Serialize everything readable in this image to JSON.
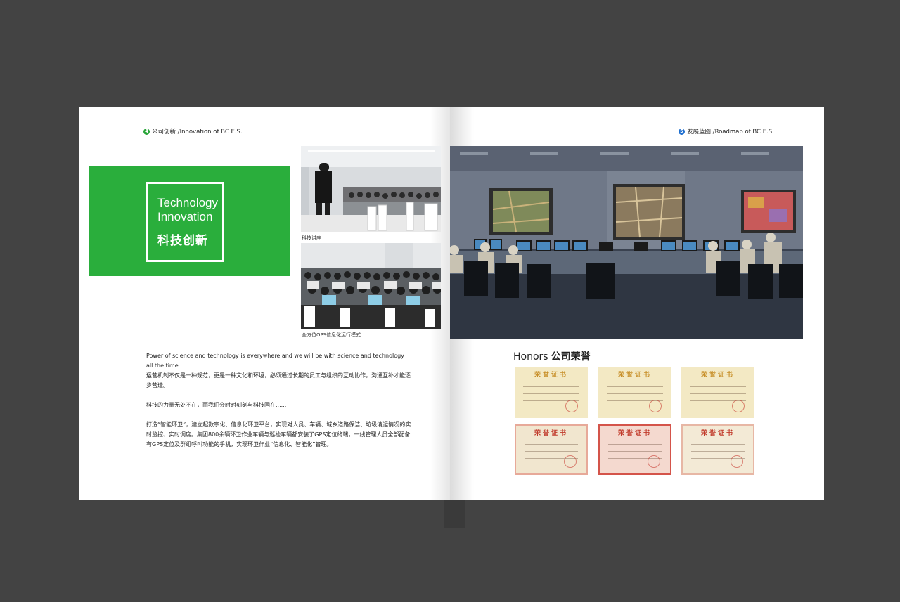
{
  "left_page": {
    "header": {
      "number": "4",
      "text": "公司创新 /Innovation of BC E.S."
    },
    "title_block": {
      "line1": "Technology",
      "line2": "Innovation",
      "cn": "科技创新"
    },
    "photos": [
      {
        "caption": "科技讲座"
      },
      {
        "caption": "全方位GPS信息化运行模式"
      }
    ],
    "paragraphs": [
      {
        "text": "Power of science and technology is everywhere and we will be with science and technology all the time..."
      },
      {
        "text": "运营机制不仅是一种规范，更是一种文化和环境，必须通过长期的员工与组织的互动协作，沟通互补才能逐步营造。"
      },
      {
        "text": "科技的力量无处不在，而我们会时时刻刻与科技同在......"
      },
      {
        "text": "打造“智能环卫”，建立起数字化、信息化环卫平台，实现对人员、车辆、城乡道路保洁、垃圾清运情况的实时监控、实时调度。集团800余辆环卫作业车辆与巡检车辆都安装了GPS定位终端，一线管理人员全部配备有GPS定位及群组呼叫功能的手机，实现环卫作业“信息化、智能化”管理。"
      }
    ]
  },
  "right_page": {
    "header": {
      "number": "5",
      "text": "发展蓝图 /Roadmap of BC E.S."
    },
    "honors": {
      "title_en": "Honors",
      "title_cn": "公司荣誉"
    },
    "certificates": [
      {
        "heading": "荣誉证书",
        "style": "gold"
      },
      {
        "heading": "荣誉证书",
        "style": "gold"
      },
      {
        "heading": "荣誉证书",
        "style": "gold"
      },
      {
        "heading": "荣誉证书",
        "style": "red"
      },
      {
        "heading": "荣誉证书",
        "style": "red"
      },
      {
        "heading": "荣誉证书",
        "style": "red"
      }
    ]
  },
  "colors": {
    "background": "#434343",
    "page": "#ffffff",
    "brand_green": "#2aae3c"
  }
}
